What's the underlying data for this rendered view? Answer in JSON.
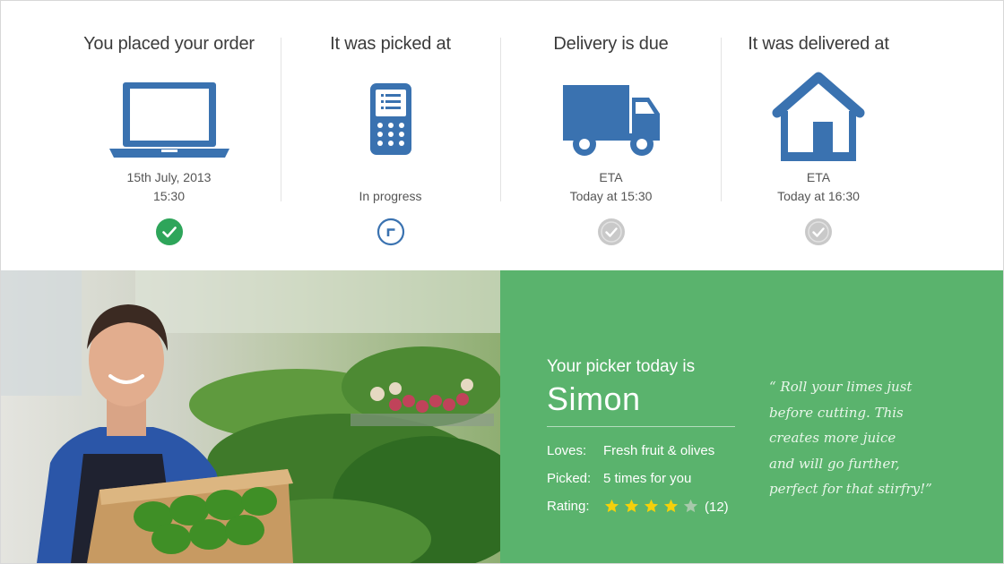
{
  "steps": [
    {
      "title": "You placed your order",
      "icon": "laptop-icon",
      "line1": "15th July, 2013",
      "line2": "15:30",
      "status": "complete"
    },
    {
      "title": "It was picked at",
      "icon": "phone-icon",
      "line1": "",
      "line2": "In progress",
      "status": "in-progress"
    },
    {
      "title": "Delivery is due",
      "icon": "truck-icon",
      "line1": "ETA",
      "line2": "Today at 15:30",
      "status": "pending"
    },
    {
      "title": "It was delivered at",
      "icon": "house-icon",
      "line1": "ETA",
      "line2": "Today at 16:30",
      "status": "pending"
    }
  ],
  "picker": {
    "heading": "Your picker today is",
    "name": "Simon",
    "loves_label": "Loves:",
    "loves_value": "Fresh fruit & olives",
    "picked_label": "Picked:",
    "picked_value": "5 times for you",
    "rating_label": "Rating:",
    "rating_stars": 4,
    "rating_max": 5,
    "rating_count": "(12)"
  },
  "quote": {
    "lines": [
      "“ Roll your limes just",
      "before cutting. This",
      "creates more juice",
      "and will go further,",
      "perfect for that stirfry!”"
    ]
  },
  "colors": {
    "brand_blue": "#3a72b0",
    "panel_green": "#5ab36d",
    "complete_green": "#2ea55a",
    "pending_grey": "#c9c9c9",
    "star_yellow": "#f4d10b",
    "star_empty": "#a7c9ab"
  }
}
